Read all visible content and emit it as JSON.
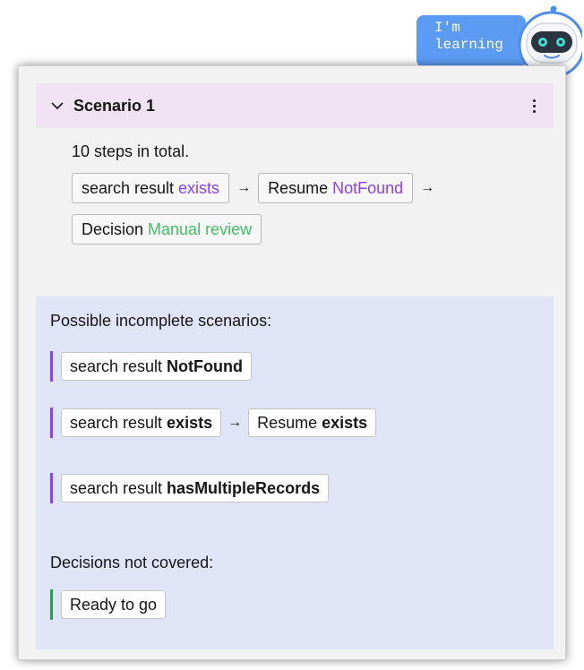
{
  "assistant": {
    "bubble_line1": "I'm",
    "bubble_line2": "learning"
  },
  "scenario": {
    "title": "Scenario 1",
    "summary": "10 steps in total.",
    "steps": [
      {
        "label": "search result",
        "value": "exists",
        "value_color": "#8a3ffc"
      },
      {
        "label": "Resume",
        "value": "NotFound",
        "value_color": "#8a3ffc"
      },
      {
        "label": "Decision",
        "value": "Manual review",
        "value_color": "#42be65"
      }
    ],
    "arrow": "→"
  },
  "incomplete": {
    "heading": "Possible incomplete scenarios:",
    "items": [
      {
        "label": "search result",
        "value": "NotFound"
      },
      {
        "label": "search result",
        "value": "exists",
        "next_label": "Resume",
        "next_value": "exists"
      },
      {
        "label": "search result",
        "value": "hasMultipleRecords"
      }
    ]
  },
  "decisions": {
    "heading": "Decisions not covered:",
    "items": [
      {
        "label": "Ready to go"
      }
    ]
  },
  "colors": {
    "header_bg": "#f0e1f3",
    "panel_bg": "#dfe4f7",
    "accent_purple": "#8a3ffc",
    "accent_green": "#24a148",
    "bubble_blue": "#5b9bf4"
  }
}
